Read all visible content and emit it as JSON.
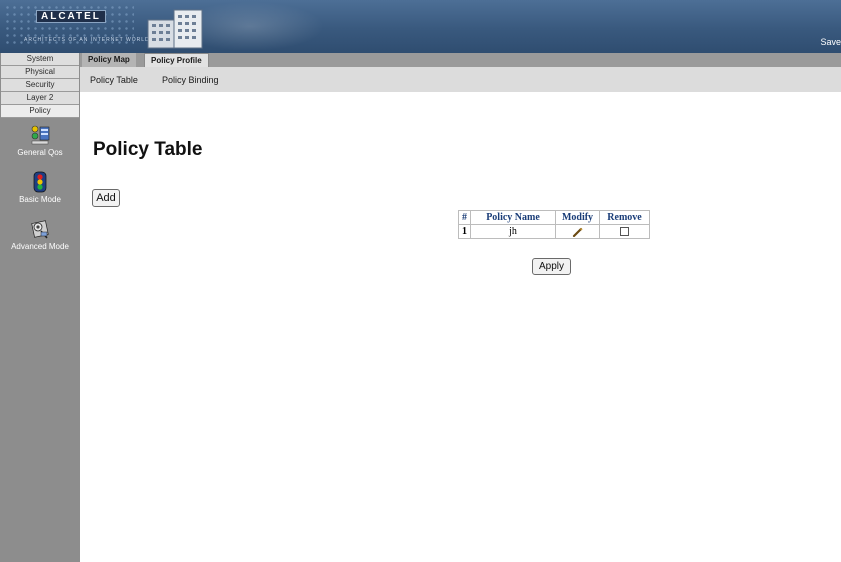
{
  "header": {
    "logo_text": "ALCATEL",
    "logo_tagline": "ARCHITECTS OF AN INTERNET WORLD",
    "save_label": "Save"
  },
  "leftnav": {
    "buttons": [
      "System",
      "Physical",
      "Security",
      "Layer 2",
      "Policy"
    ],
    "icons": [
      {
        "label": "General Qos",
        "icon": "general-qos-icon"
      },
      {
        "label": "Basic Mode",
        "icon": "traffic-light-icon"
      },
      {
        "label": "Advanced Mode",
        "icon": "advanced-mode-icon"
      }
    ]
  },
  "tabs": {
    "policy_map": "Policy Map",
    "policy_profile": "Policy Profile"
  },
  "subtabs": {
    "policy_table": "Policy Table",
    "policy_binding": "Policy Binding"
  },
  "main": {
    "title": "Policy Table",
    "add_label": "Add",
    "apply_label": "Apply",
    "table": {
      "headers": [
        "#",
        "Policy Name",
        "Modify",
        "Remove"
      ],
      "rows": [
        {
          "index": "1",
          "name": "jh",
          "modify_icon": "pencil-icon",
          "remove": false
        }
      ]
    }
  },
  "colors": {
    "header": "#3d5e85",
    "nav_background": "#8d8d8d",
    "table_header_text": "#1a3d78"
  }
}
